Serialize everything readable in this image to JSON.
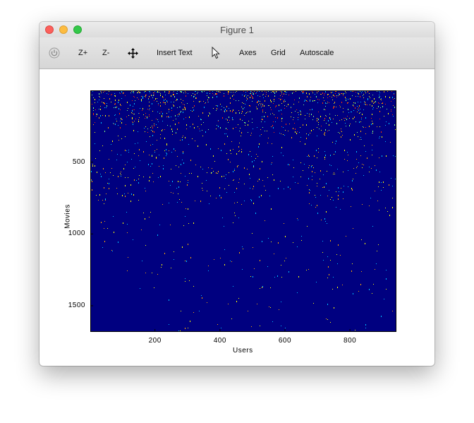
{
  "window": {
    "title": "Figure 1"
  },
  "toolbar": {
    "reset_icon": "reset-icon",
    "zoom_in_label": "Z+",
    "zoom_out_label": "Z-",
    "pan_icon": "pan-arrows-icon",
    "insert_text_label": "Insert Text",
    "pointer_icon": "pointer-arrow-icon",
    "axes_label": "Axes",
    "grid_label": "Grid",
    "autoscale_label": "Autoscale"
  },
  "colors": {
    "background": "#000080",
    "low": "#00bfff",
    "mid": "#ffff00",
    "high": "#ff3000"
  },
  "chart_data": {
    "type": "heatmap",
    "xlabel": "Users",
    "ylabel": "Movies",
    "xlim": [
      1,
      943
    ],
    "ylim": [
      1682,
      1
    ],
    "x_ticks": [
      200,
      400,
      600,
      800
    ],
    "y_ticks": [
      500,
      1000,
      1500
    ],
    "colormap": "jet",
    "description_values": "sparse user-movie rating matrix, values 0-5, 0 shown as dark blue"
  }
}
